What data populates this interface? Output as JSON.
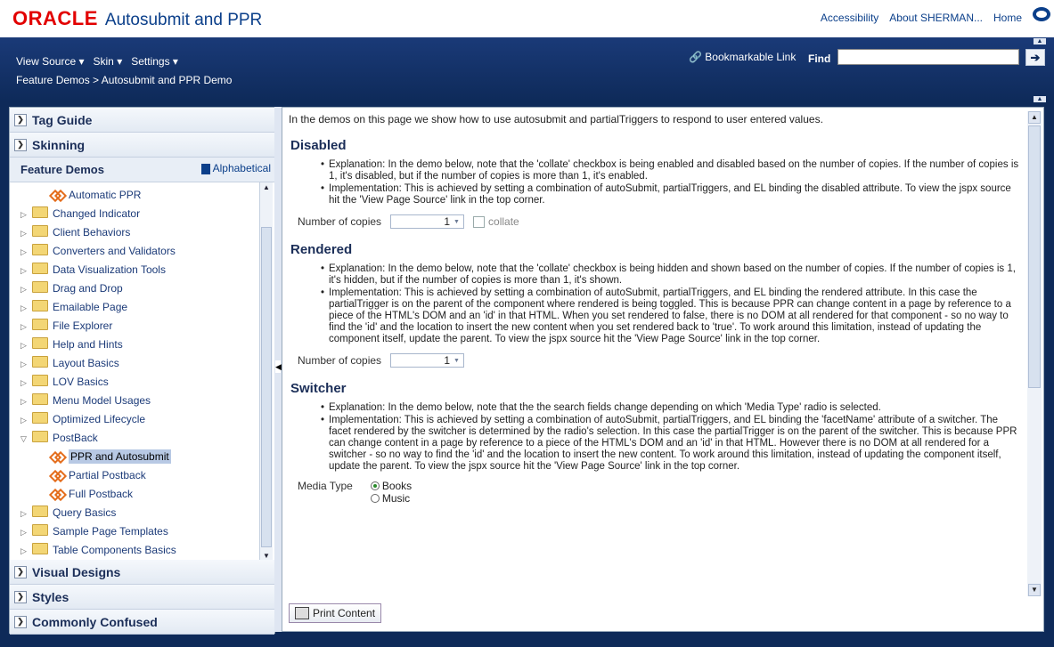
{
  "header": {
    "brand": "ORACLE",
    "title": "Autosubmit and PPR",
    "links": [
      "Accessibility",
      "About SHERMAN...",
      "Home"
    ]
  },
  "nav": {
    "menus": [
      "View Source ▾",
      "Skin ▾",
      "Settings ▾"
    ],
    "breadcrumb_parent": "Feature Demos",
    "breadcrumb_sep": " > ",
    "breadcrumb_current": "Autosubmit and PPR Demo",
    "bookmark": "Bookmarkable Link",
    "find_label": "Find",
    "find_value": "",
    "go_glyph": "➔"
  },
  "sidebar": {
    "tag_guide": "Tag Guide",
    "skinning": "Skinning",
    "feature_demos": "Feature Demos",
    "alphabetical": "Alphabetical",
    "tree": [
      {
        "label": "Automatic PPR",
        "kind": "leaf"
      },
      {
        "label": "Changed Indicator",
        "kind": "folder"
      },
      {
        "label": "Client Behaviors",
        "kind": "folder"
      },
      {
        "label": "Converters and Validators",
        "kind": "folder"
      },
      {
        "label": "Data Visualization Tools",
        "kind": "folder"
      },
      {
        "label": "Drag and Drop",
        "kind": "folder"
      },
      {
        "label": "Emailable Page",
        "kind": "folder"
      },
      {
        "label": "File Explorer",
        "kind": "folder"
      },
      {
        "label": "Help and Hints",
        "kind": "folder"
      },
      {
        "label": "Layout Basics",
        "kind": "folder"
      },
      {
        "label": "LOV Basics",
        "kind": "folder"
      },
      {
        "label": "Menu Model Usages",
        "kind": "folder"
      },
      {
        "label": "Optimized Lifecycle",
        "kind": "folder"
      },
      {
        "label": "PostBack",
        "kind": "folder-open"
      },
      {
        "label": "PPR and Autosubmit",
        "kind": "leaf-selected"
      },
      {
        "label": "Partial Postback",
        "kind": "leaf"
      },
      {
        "label": "Full Postback",
        "kind": "leaf"
      },
      {
        "label": "Query Basics",
        "kind": "folder"
      },
      {
        "label": "Sample Page Templates",
        "kind": "folder"
      },
      {
        "label": "Table Components Basics",
        "kind": "folder"
      }
    ],
    "visual_designs": "Visual Designs",
    "styles": "Styles",
    "commonly_confused": "Commonly Confused"
  },
  "main": {
    "intro": "In the demos on this page we show how to use autosubmit and partialTriggers to respond to user entered values.",
    "sections": [
      {
        "title": "Disabled",
        "bullets": [
          "Explanation: In the demo below, note that the 'collate' checkbox is being enabled and disabled based on the number of copies. If the number of copies is 1, it's disabled, but if the number of copies is more than 1, it's enabled.",
          "Implementation: This is achieved by setting a combination of autoSubmit, partialTriggers, and EL binding the disabled attribute. To view the jspx source hit the 'View Page Source' link in the top corner."
        ],
        "field_label": "Number of copies",
        "field_value": "1",
        "checkbox_label": "collate"
      },
      {
        "title": "Rendered",
        "bullets": [
          "Explanation: In the demo below, note that the 'collate' checkbox is being hidden and shown based on the number of copies. If the number of copies is 1, it's hidden, but if the number of copies is more than 1, it's shown.",
          "Implementation: This is achieved by setting a combination of autoSubmit, partialTriggers, and EL binding the rendered attribute. In this case the partialTrigger is on the parent of the component where rendered is being toggled. This is because PPR can change content in a page by reference to a piece of the HTML's DOM and an 'id' in that HTML. When you set rendered to false, there is no DOM at all rendered for that component - so no way to find the 'id' and the location to insert the new content when you set rendered back to 'true'. To work around this limitation, instead of updating the component itself, update the parent. To view the jspx source hit the 'View Page Source' link in the top corner."
        ],
        "field_label": "Number of copies",
        "field_value": "1"
      },
      {
        "title": "Switcher",
        "bullets": [
          "Explanation: In the demo below, note that the the search fields change depending on which 'Media Type' radio is selected.",
          "Implementation: This is achieved by setting a combination of autoSubmit, partialTriggers, and EL binding the 'facetName' attribute of a switcher. The facet rendered by the switcher is determined by the radio's selection. In this case the partialTrigger is on the parent of the switcher. This is because PPR can change content in a page by reference to a piece of the HTML's DOM and an 'id' in that HTML. However there is no DOM at all rendered for a switcher - so no way to find the 'id' and the location to insert the new content. To work around this limitation, instead of updating the component itself, update the parent. To view the jspx source hit the 'View Page Source' link in the top corner."
        ],
        "media_label": "Media Type",
        "radio_options": [
          "Books",
          "Music"
        ]
      }
    ],
    "print_button": "Print Content"
  }
}
